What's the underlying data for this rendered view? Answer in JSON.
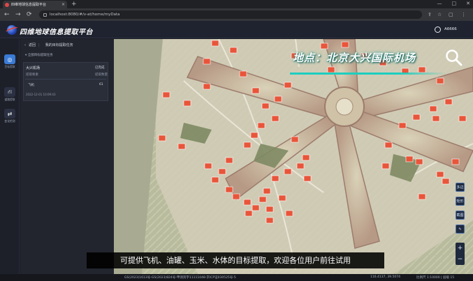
{
  "browser": {
    "tab_title": "四维地球信息提取平台",
    "tab_close": "×",
    "new_tab": "+",
    "url": "localhost:8080/#/v-at/home/myData",
    "win_ctrls": [
      "—",
      "□",
      "✕"
    ],
    "nav": [
      "←",
      "→",
      "⟳"
    ]
  },
  "app": {
    "title": "四维地球信息提取平台",
    "user": "A6666"
  },
  "sidebar": {
    "items": [
      {
        "label": "目标提取",
        "icon": "target-icon",
        "color": "#3a7bd5"
      },
      {
        "label": "道路提取",
        "icon": "road-icon",
        "color": "#2b3142"
      },
      {
        "label": "变化检测",
        "icon": "change-icon",
        "color": "#2b3142"
      }
    ]
  },
  "panel": {
    "back_label": "返回",
    "breadcrumb": "我的目标提取任务",
    "subtitle": "全部目标提取任务",
    "card": {
      "name": "大兴机场",
      "status": "已完成",
      "col1": "提取要素",
      "col2": "提取数量",
      "target": "飞机",
      "count": "61",
      "time": "2022-12-01 10:09:43"
    }
  },
  "map": {
    "location_title": "地点：北京大兴国际机场",
    "accent": "#1ccfbf",
    "detection_color": "#e8553a",
    "toolbar": [
      "多边",
      "矩形",
      "截图",
      "✎"
    ]
  },
  "zoom": {
    "in": "+",
    "out": "−"
  },
  "subtitle": "可提供飞机、油罐、玉米、水体的目标提取，欢迎各位用户前往试用",
  "status": {
    "copyright": "GS(2023)1613号-GS(2023)824号-甲测资字11111048-京ICP证030525号-5",
    "coord": "116.4137, 39.5074",
    "scale": "比例尺 1:10000 | 层级 15"
  }
}
